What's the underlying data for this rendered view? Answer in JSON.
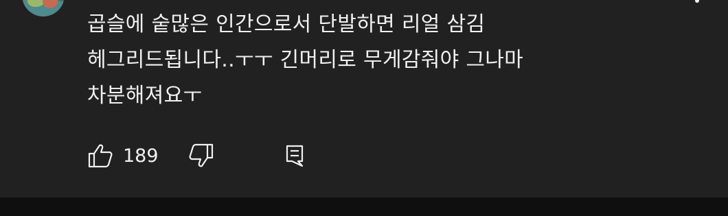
{
  "comment": {
    "text_lines": [
      "곱슬에 숱많은 인간으로서 단발하면 리얼 삼김",
      "헤그리드됩니다..ㅜㅜ 긴머리로 무게감줘야 그나마",
      "차분해져요ㅜ"
    ],
    "like_count": "189",
    "icons": {
      "avatar": "avatar-image",
      "more": "more-vertical-icon",
      "like": "thumbs-up-icon",
      "dislike": "thumbs-down-icon",
      "reply": "reply-icon"
    },
    "colors": {
      "background": "#212121",
      "text": "#f1f1f1",
      "page_bottom": "#0f0f0f"
    }
  }
}
